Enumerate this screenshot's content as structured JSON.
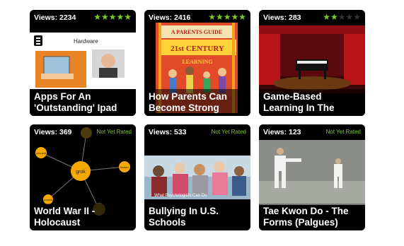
{
  "cards": [
    {
      "views": "Views: 2234",
      "rating": 5,
      "title": "Apps For An\n'Outstanding' Ipad",
      "thumb_caption": "Hardware"
    },
    {
      "views": "Views: 2416",
      "rating": 5,
      "title": "How Parents Can\nBecome Strong",
      "thumb_caption_1": "A PARENTS GUIDE",
      "thumb_caption_2": "21st CENTURY",
      "thumb_caption_3": "LEARNING"
    },
    {
      "views": "Views: 283",
      "rating": 2,
      "title": "Game-Based\nLearning In The"
    },
    {
      "views": "Views: 369",
      "rating_text": "Not Yet Rated",
      "title": "World War II -\nHolocaust",
      "nodes": [
        "grok",
        "connect",
        "lesson",
        "conobs"
      ]
    },
    {
      "views": "Views: 533",
      "rating_text": "Not Yet Rated",
      "title": "Bullying In U.S.\nSchools",
      "thumb_caption": "What Psychologists Can Do"
    },
    {
      "views": "Views: 123",
      "rating_text": "Not Yet Rated",
      "title": "Tae Kwon Do - The\nForms (Palgues)"
    }
  ],
  "colors": {
    "accent_green": "#7ec82a",
    "card_bg": "#000000"
  }
}
